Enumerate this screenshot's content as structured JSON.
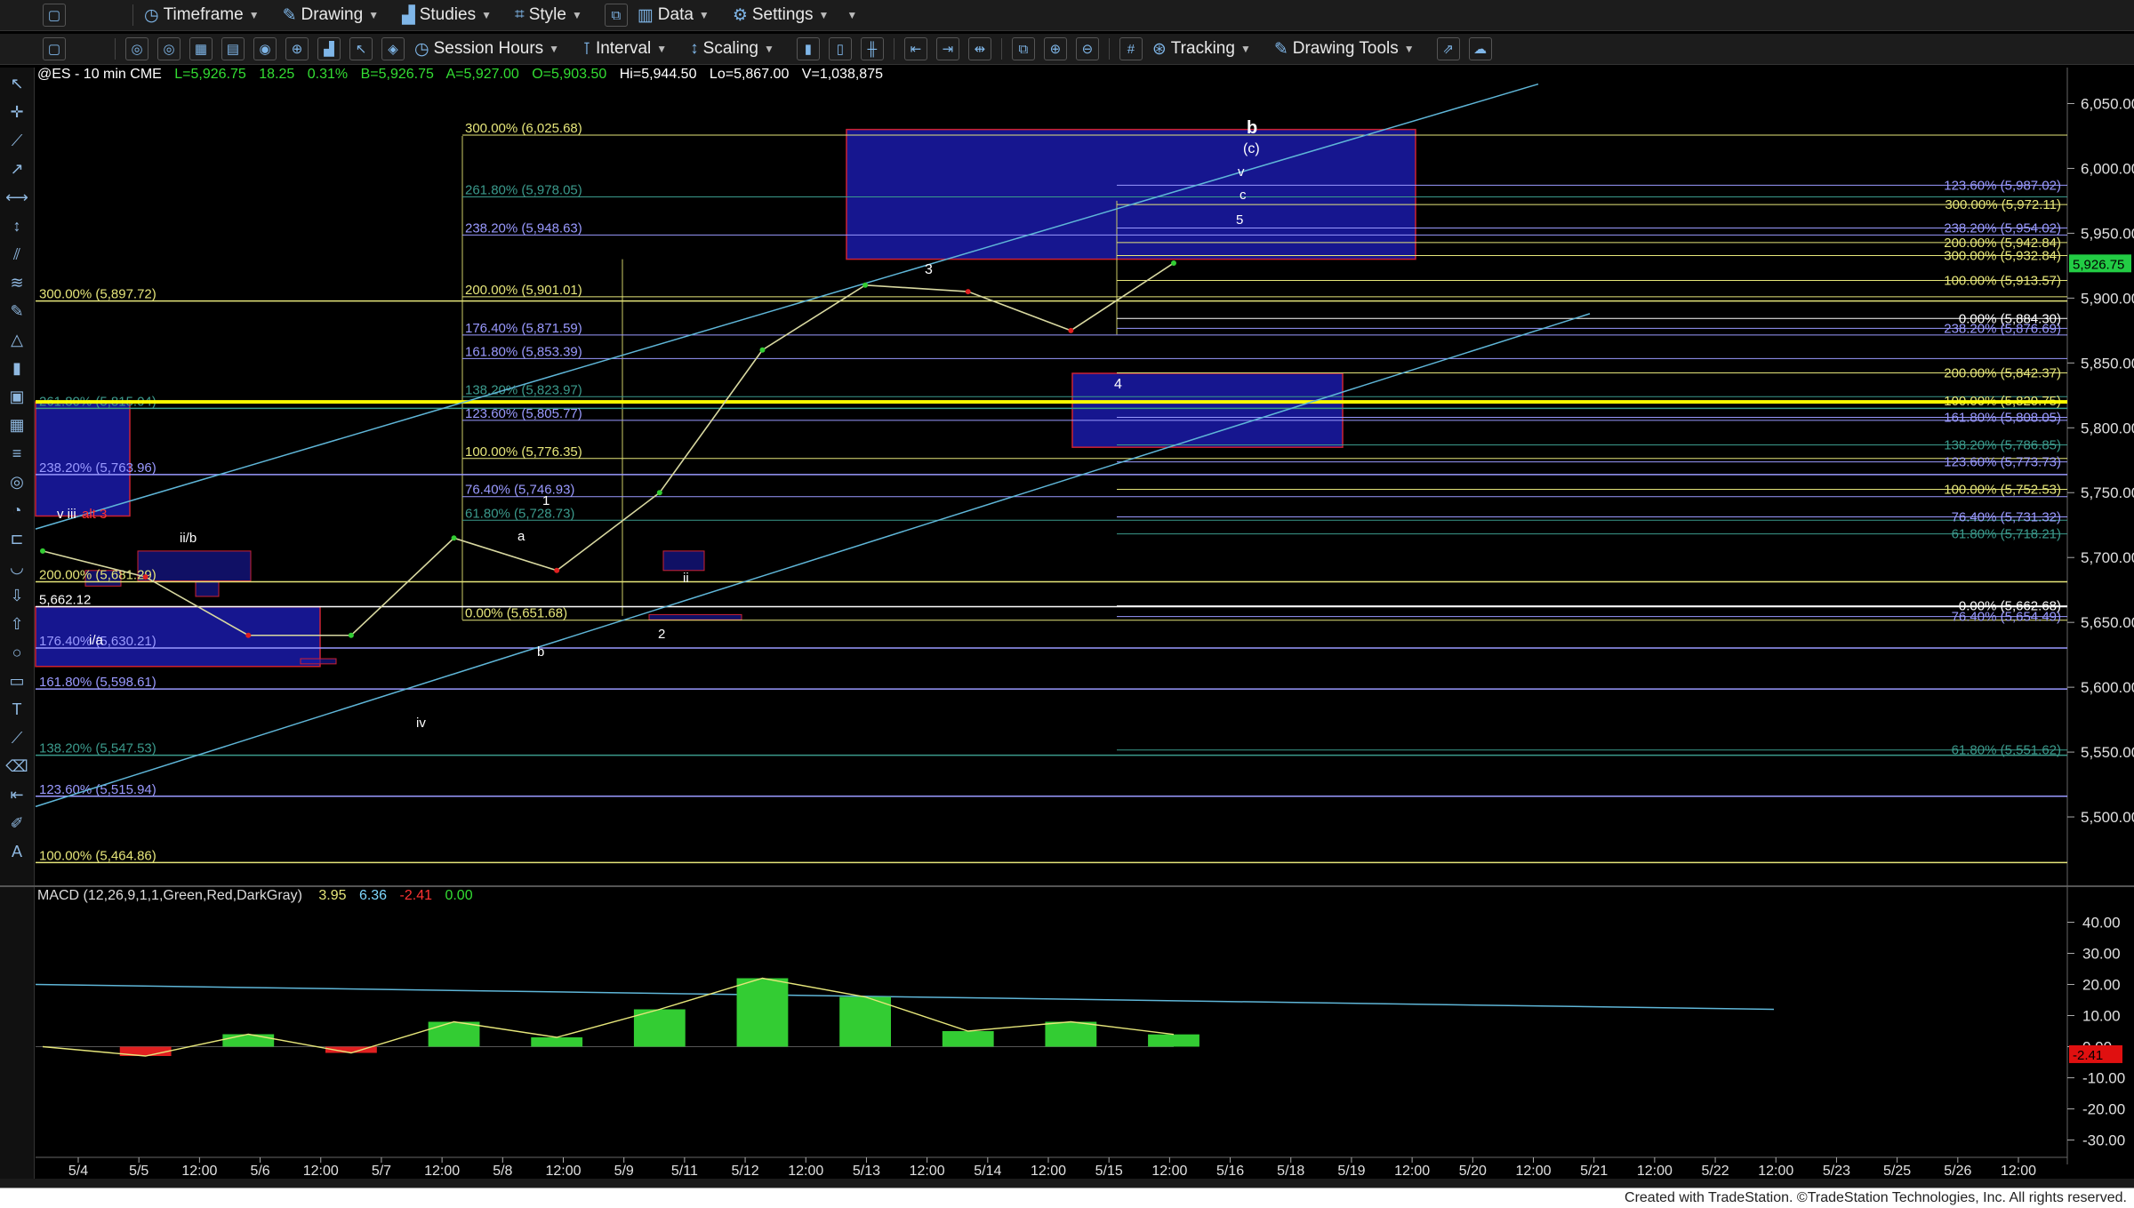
{
  "toolbar1": [
    {
      "icon": "timeframe-icon",
      "label": "Timeframe"
    },
    {
      "icon": "drawing-icon",
      "label": "Drawing"
    },
    {
      "icon": "studies-icon",
      "label": "Studies"
    },
    {
      "icon": "style-icon",
      "label": "Style"
    },
    {
      "icon": "data-icon",
      "label": "Data"
    },
    {
      "icon": "settings-icon",
      "label": "Settings"
    }
  ],
  "toolbar2": [
    {
      "icon": "session-hours-icon",
      "label": "Session Hours"
    },
    {
      "icon": "interval-icon",
      "label": "Interval"
    },
    {
      "icon": "scaling-icon",
      "label": "Scaling"
    },
    {
      "icon": "tracking-icon",
      "label": "Tracking"
    },
    {
      "icon": "drawing-tools-icon",
      "label": "Drawing Tools"
    }
  ],
  "symbol_header": {
    "symbol": "@ES - 10 min  CME",
    "last": "L=5,926.75",
    "change": "18.25",
    "pct": "0.31%",
    "bid": "B=5,926.75",
    "ask": "A=5,927.00",
    "open": "O=5,903.50",
    "high": "Hi=5,944.50",
    "low": "Lo=5,867.00",
    "volume": "V=1,038,875"
  },
  "price_axis": {
    "ticks": [
      "6,050.00",
      "6,000.00",
      "5,950.00",
      "5,900.00",
      "5,850.00",
      "5,800.00",
      "5,750.00",
      "5,700.00",
      "5,650.00",
      "5,600.00",
      "5,550.00",
      "5,500.00"
    ],
    "last_price": "5,926.75"
  },
  "macd": {
    "label": "MACD (12,26,9,1,1,Green,Red,DarkGray)",
    "values": [
      "3.95",
      "6.36",
      "-2.41",
      "0.00"
    ],
    "ticks": [
      "40.00",
      "30.00",
      "20.00",
      "10.00",
      "0.00",
      "-10.00",
      "-20.00",
      "-30.00"
    ],
    "last_value": "-2.41"
  },
  "time_axis": [
    "5/4",
    "5/5",
    "12:00",
    "5/6",
    "12:00",
    "5/7",
    "12:00",
    "5/8",
    "12:00",
    "5/9",
    "5/11",
    "5/12",
    "12:00",
    "5/13",
    "12:00",
    "5/14",
    "12:00",
    "5/15",
    "12:00",
    "5/16",
    "5/18",
    "5/19",
    "12:00",
    "5/20",
    "12:00",
    "5/21",
    "12:00",
    "5/22",
    "12:00",
    "5/23",
    "5/25",
    "5/26",
    "12:00"
  ],
  "fib_left": [
    {
      "label": "300.00% (5,897.72)",
      "color": "#e6e67a"
    },
    {
      "label": "261.80% (5,815.04)",
      "color": "#3b9a8c"
    },
    {
      "label": "238.20% (5,763.96)",
      "color": "#9a9aff"
    },
    {
      "label": "200.00% (5,681.29)",
      "color": "#e6e67a"
    },
    {
      "label": "5,662.12",
      "color": "#ffffff"
    },
    {
      "label": "176.40% (5,630.21)",
      "color": "#9a9aff"
    },
    {
      "label": "161.80% (5,598.61)",
      "color": "#9a9aff"
    },
    {
      "label": "138.20% (5,547.53)",
      "color": "#3b9a8c"
    },
    {
      "label": "123.60% (5,515.94)",
      "color": "#9a9aff"
    },
    {
      "label": "100.00% (5,464.86)",
      "color": "#e6e67a"
    }
  ],
  "fib_mid": [
    {
      "label": "300.00% (6,025.68)",
      "color": "#e6e67a"
    },
    {
      "label": "261.80% (5,978.05)",
      "color": "#3b9a8c"
    },
    {
      "label": "238.20% (5,948.63)",
      "color": "#9a9aff"
    },
    {
      "label": "200.00% (5,901.01)",
      "color": "#e6e67a"
    },
    {
      "label": "176.40% (5,871.59)",
      "color": "#9a9aff"
    },
    {
      "label": "161.80% (5,853.39)",
      "color": "#9a9aff"
    },
    {
      "label": "138.20% (5,823.97)",
      "color": "#3b9a8c"
    },
    {
      "label": "123.60% (5,805.77)",
      "color": "#9a9aff"
    },
    {
      "label": "100.00% (5,776.35)",
      "color": "#e6e67a"
    },
    {
      "label": "76.40% (5,746.93)",
      "color": "#9a9aff"
    },
    {
      "label": "61.80% (5,728.73)",
      "color": "#3b9a8c"
    },
    {
      "label": "0.00% (5,651.68)",
      "color": "#e6e67a"
    }
  ],
  "fib_right": [
    {
      "label": "123.60% (5,987.02)",
      "color": "#9a9aff"
    },
    {
      "label": "300.00% (5,972.11)",
      "color": "#e6e67a"
    },
    {
      "label": "238.20% (5,954.02)",
      "color": "#9a9aff"
    },
    {
      "label": "200.00% (5,942.84)",
      "color": "#e6e67a"
    },
    {
      "label": "300.00% (5,932.84)",
      "color": "#e6e67a"
    },
    {
      "label": "100.00% (5,913.57)",
      "color": "#e6e67a"
    },
    {
      "label": "0.00% (5,884.30)",
      "color": "#ffffff"
    },
    {
      "label": "238.20% (5,876.69)",
      "color": "#9a9aff"
    },
    {
      "label": "200.00% (5,842.37)",
      "color": "#e6e67a"
    },
    {
      "label": "100.00% (5,820.75)",
      "color": "#e6e67a"
    },
    {
      "label": "161.80% (5,808.05)",
      "color": "#9a9aff"
    },
    {
      "label": "138.20% (5,786.85)",
      "color": "#3b9a8c"
    },
    {
      "label": "123.60% (5,773.73)",
      "color": "#9a9aff"
    },
    {
      "label": "100.00% (5,752.53)",
      "color": "#e6e67a"
    },
    {
      "label": "76.40% (5,731.32)",
      "color": "#9a9aff"
    },
    {
      "label": "61.80% (5,718.21)",
      "color": "#3b9a8c"
    },
    {
      "label": "0.00% (5,662.68)",
      "color": "#ffffff"
    },
    {
      "label": "76.40% (5,654.49)",
      "color": "#9a9aff"
    },
    {
      "label": "61.80% (5,551.62)",
      "color": "#3b9a8c"
    }
  ],
  "wave_labels": [
    "b",
    "(c)",
    "v",
    "c",
    "5",
    "3",
    "4",
    "v iii",
    "alt 3",
    "ii/b",
    "i/a",
    "iv",
    "a",
    "b",
    "1",
    "2",
    "ii"
  ],
  "footer": "Created with TradeStation. ©TradeStation Technologies, Inc. All rights reserved.",
  "colors": {
    "background": "#000000",
    "up": "#33cc33",
    "down": "#e02020",
    "fib_yellow": "#e6e67a",
    "fib_blue": "#9a9aff",
    "fib_teal": "#3b9a8c",
    "box_fill": "#1a1aa8",
    "box_border": "#cc2233",
    "trendline": "#5fb6d8"
  },
  "chart_data": {
    "type": "line",
    "title": "@ES - 10 min CME",
    "xlabel": "",
    "ylabel": "",
    "ylim": [
      5450,
      6075
    ],
    "x": [
      "5/4",
      "5/5",
      "5/6",
      "5/7",
      "5/8",
      "5/9",
      "5/11",
      "5/12",
      "5/13",
      "5/14",
      "5/15",
      "5/15 12:00"
    ],
    "series": [
      {
        "values": [
          5705,
          5685,
          5640,
          5640,
          5715,
          5690,
          5750,
          5860,
          5910,
          5905,
          5875,
          5927
        ]
      }
    ],
    "macd": {
      "ylim": [
        -35,
        45
      ],
      "values": [
        0,
        -3,
        4,
        -2,
        8,
        3,
        12,
        22,
        16,
        5,
        8,
        3.95
      ]
    }
  }
}
